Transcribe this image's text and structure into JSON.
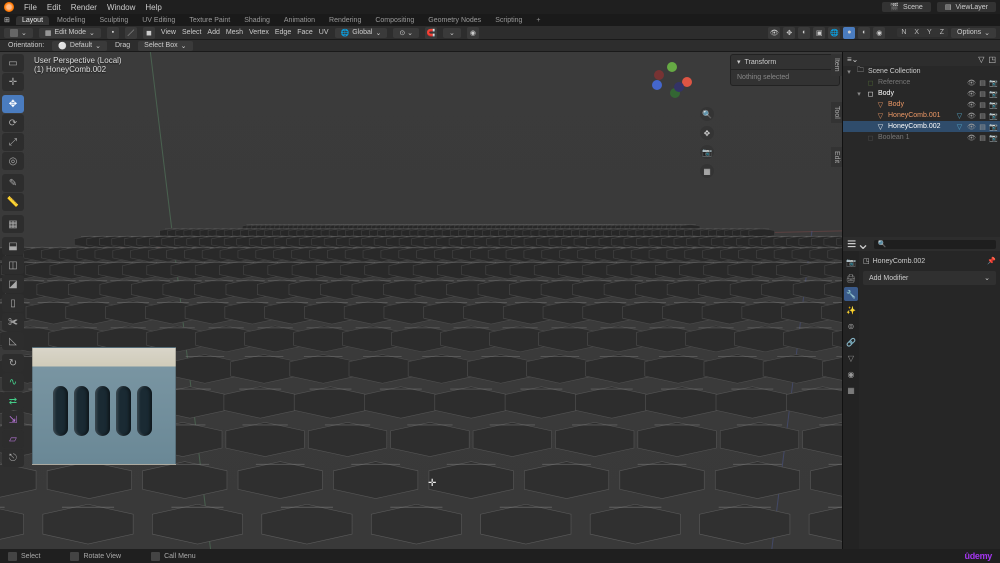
{
  "menubar": {
    "items": [
      "File",
      "Edit",
      "Render",
      "Window",
      "Help"
    ],
    "scene": "Scene",
    "viewlayer": "ViewLayer"
  },
  "workspaces": [
    "Layout",
    "Modeling",
    "Sculpting",
    "UV Editing",
    "Texture Paint",
    "Shading",
    "Animation",
    "Rendering",
    "Compositing",
    "Geometry Nodes",
    "Scripting"
  ],
  "active_workspace": "Layout",
  "editor_header": {
    "mode": "Edit Mode",
    "menus": [
      "View",
      "Select",
      "Add",
      "Mesh",
      "Vertex",
      "Edge",
      "Face",
      "UV"
    ],
    "orientation": "Global",
    "snap": "⌄"
  },
  "tool_settings": {
    "orientation_label": "Orientation:",
    "orientation_value": "Default",
    "drag_label": "Drag",
    "select_mode": "Select Box"
  },
  "viewport": {
    "info_line1": "User Perspective (Local)",
    "info_line2": "(1) HoneyComb.002",
    "n_panel": {
      "title": "Transform",
      "body": "Nothing selected"
    },
    "axis_lock": [
      "N",
      "X",
      "Y",
      "Z"
    ],
    "options_btn": "Options"
  },
  "outliner": {
    "title": "Scene Collection",
    "rows": [
      {
        "name": "Reference",
        "color": "#7a4",
        "disabled": true,
        "ind": 1,
        "icon": "◻"
      },
      {
        "name": "Body",
        "color": "#fff",
        "ind": 1,
        "icon": "◻",
        "tri": "▾"
      },
      {
        "name": "Body",
        "color": "#e96",
        "ind": 2,
        "icon": "▽"
      },
      {
        "name": "HoneyComb.001",
        "color": "#e96",
        "ind": 2,
        "icon": "▽",
        "mod": true
      },
      {
        "name": "HoneyComb.002",
        "color": "#fff",
        "ind": 2,
        "icon": "▽",
        "sel": true,
        "mod": true
      },
      {
        "name": "Boolean",
        "color": "#777",
        "ind": 1,
        "icon": "◻",
        "disabled": true,
        "count": "1"
      }
    ]
  },
  "properties": {
    "crumb": "HoneyComb.002",
    "add_modifier": "Add Modifier"
  },
  "statusbar": {
    "select": "Select",
    "rotate": "Rotate View",
    "menu": "Call Menu",
    "brand": "demy"
  }
}
